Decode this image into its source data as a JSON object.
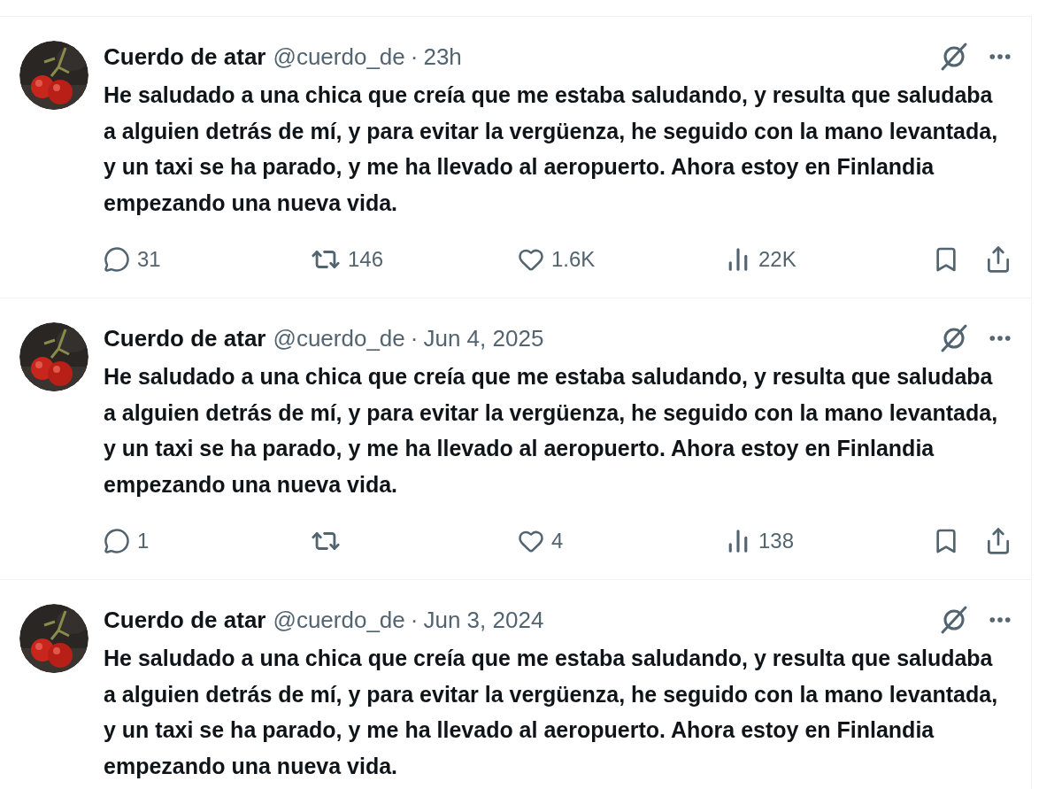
{
  "tweets": [
    {
      "name": "Cuerdo de atar",
      "handle": "@cuerdo_de",
      "separator": "·",
      "time": "23h",
      "text": "He saludado a una chica que creía que me estaba saludando, y resulta que saludaba a alguien detrás de mí, y para evitar la vergüenza, he seguido con la mano levantada, y un taxi se ha parado, y me ha llevado al aeropuerto. Ahora estoy en Finlandia empezando una nueva vida.",
      "stats": {
        "replies": "31",
        "reposts": "146",
        "likes": "1.6K",
        "views": "22K"
      }
    },
    {
      "name": "Cuerdo de atar",
      "handle": "@cuerdo_de",
      "separator": "·",
      "time": "Jun 4, 2025",
      "text": "He saludado a una chica que creía que me estaba saludando, y resulta que saludaba a alguien detrás de mí, y para evitar la vergüenza, he seguido con la mano levantada, y un taxi se ha parado, y me ha llevado al aeropuerto. Ahora estoy en Finlandia empezando una nueva vida.",
      "stats": {
        "replies": "1",
        "likes": "4",
        "views": "138"
      }
    },
    {
      "name": "Cuerdo de atar",
      "handle": "@cuerdo_de",
      "separator": "·",
      "time": "Jun 3, 2024",
      "text": "He saludado a una chica que creía que me estaba saludando, y resulta que saludaba a alguien detrás de mí, y para evitar la vergüenza, he seguido con la mano levantada, y un taxi se ha parado, y me ha llevado al aeropuerto. Ahora estoy en Finlandia empezando una nueva vida."
    }
  ]
}
